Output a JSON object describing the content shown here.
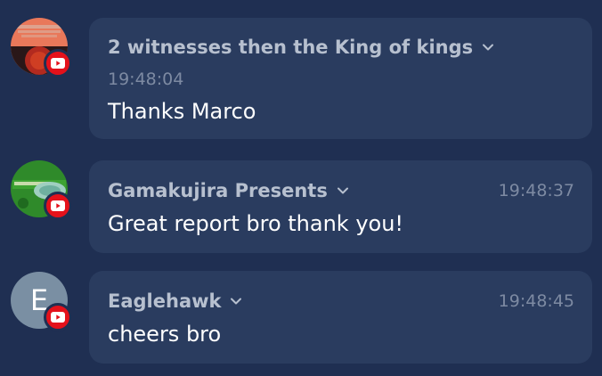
{
  "messages": [
    {
      "author": "2 witnesses then the King of kings",
      "time": "19:48:04",
      "text": "Thanks Marco",
      "avatar_icon": "channel-avatar-image",
      "badge_icon": "youtube-icon"
    },
    {
      "author": "Gamakujira Presents",
      "time": "19:48:37",
      "text": "Great report bro thank you!",
      "avatar_icon": "channel-avatar-image",
      "badge_icon": "youtube-icon"
    },
    {
      "author": "Eaglehawk",
      "time": "19:48:45",
      "text": "cheers bro",
      "avatar_letter": "E",
      "badge_icon": "youtube-icon"
    }
  ],
  "colors": {
    "background": "#1f2f52",
    "bubble": "#2a3c5f",
    "author": "#b7c0cf",
    "timestamp": "#7d8aa2",
    "text": "#ffffff",
    "youtube_badge": "#e4111b"
  }
}
